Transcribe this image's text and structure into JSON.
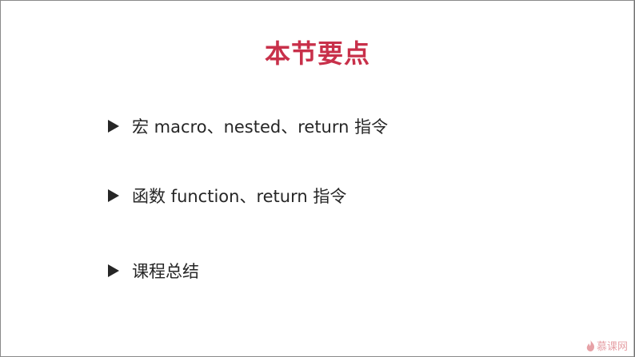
{
  "slide": {
    "title": "本节要点",
    "bullets": [
      {
        "text": "宏 macro、nested、return 指令"
      },
      {
        "text": "函数 function、return 指令"
      },
      {
        "text": "课程总结"
      }
    ]
  },
  "watermark": {
    "text": "慕课网",
    "icon": "flame-icon"
  },
  "colors": {
    "title": "#c8304a",
    "text": "#262626",
    "marker": "#262626",
    "background": "#ffffff",
    "watermark": "#e6a1a6"
  }
}
